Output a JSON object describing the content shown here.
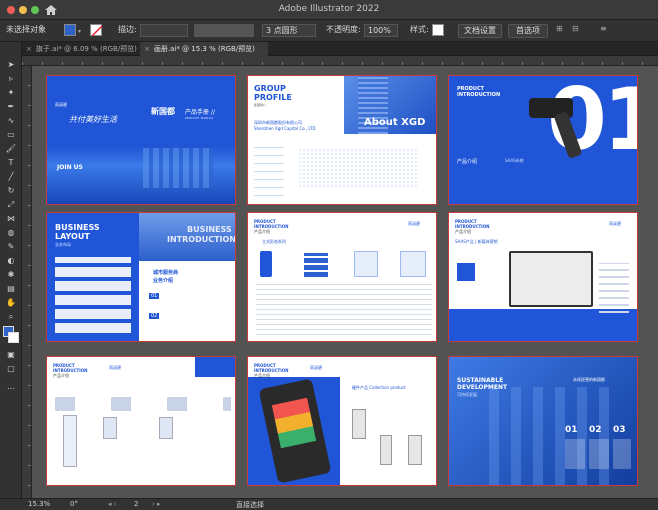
{
  "app": {
    "title": "Adobe Illustrator 2022"
  },
  "control_bar": {
    "selection_label": "未选择对象",
    "stroke_label": "描边:",
    "brush_label": "3 点圆形",
    "opacity_label": "不透明度:",
    "opacity_value": "100%",
    "style_label": "样式:",
    "doc_setup_label": "文档设置",
    "prefs_label": "首选项"
  },
  "tabs": [
    {
      "label": "旗子.ai* @ 6.09 % (RGB/预览)",
      "active": false
    },
    {
      "label": "画册.ai* @ 15.3 % (RGB/预览)",
      "active": true
    }
  ],
  "artboards": {
    "b1": {
      "brand": "雨溪碧",
      "calligraphy": "共付美好生活",
      "title": "新国都",
      "subtitle": "产品手册 //",
      "small": "PRODUCT MANUAL",
      "join": "JOIN US"
    },
    "b2": {
      "group": "GROUP",
      "profile": "PROFILE",
      "tag": "集团简介",
      "company_cn": "深圳市新国都股份有限公司",
      "company_en": "Shenzhen Xgd Capital Co., LTD",
      "about": "About XGD"
    },
    "b3": {
      "eyebrow_1": "PRODUCT",
      "eyebrow_2": "INTRODUCTION",
      "big_num": "01",
      "label": "产品介绍",
      "sub": "SAAS系统"
    },
    "b4": {
      "heading_1": "BUSINESS",
      "heading_2": "LAYOUT",
      "sub": "业务布局",
      "bg_1": "BUSINESS",
      "bg_2": "INTRODUCTION",
      "mid_1": "城市服务商",
      "mid_2": "业务介绍",
      "n1": "01",
      "n2": "02"
    },
    "b5": {
      "eyebrow_1": "PRODUCT",
      "eyebrow_2": "INTRODUCTION",
      "label": "产品介绍",
      "brand": "雨溪碧",
      "section": "立式形态系列"
    },
    "b6": {
      "eyebrow_1": "PRODUCT",
      "eyebrow_2": "INTRODUCTION",
      "label": "产品介绍",
      "brand": "雨溪碧",
      "section": "SAAS产品 | 新媒体营销"
    },
    "b7": {
      "eyebrow_1": "PRODUCT",
      "eyebrow_2": "INTRODUCTION",
      "label": "产品介绍",
      "brand": "雨溪碧"
    },
    "b8": {
      "eyebrow_1": "PRODUCT",
      "eyebrow_2": "INTRODUCTION",
      "label": "产品介绍",
      "brand": "雨溪碧",
      "section": "硬件产品 Collection product"
    },
    "b9": {
      "heading_1": "SUSTAINABLE",
      "heading_2": "DEVELOPMENT",
      "sub": "可持续发展",
      "tag": "永续经营的新国都",
      "n1": "01",
      "n2": "02",
      "n3": "03"
    }
  },
  "status": {
    "zoom": "15.3%",
    "angle": "0°",
    "page": "2",
    "tool": "直接选择"
  }
}
